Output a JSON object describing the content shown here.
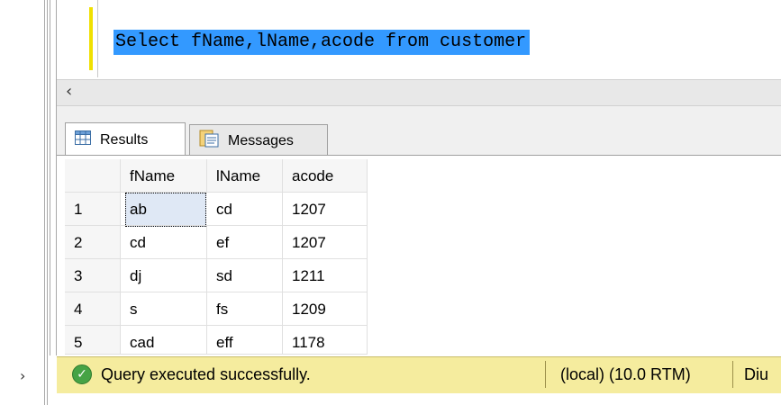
{
  "editor": {
    "sql": "Select fName,lName,acode from customer"
  },
  "tabs": {
    "results": "Results",
    "messages": "Messages"
  },
  "grid": {
    "columns": [
      "fName",
      "lName",
      "acode"
    ],
    "rows": [
      {
        "num": "1",
        "fName": "ab",
        "lName": "cd",
        "acode": "1207"
      },
      {
        "num": "2",
        "fName": "cd",
        "lName": "ef",
        "acode": "1207"
      },
      {
        "num": "3",
        "fName": "dj",
        "lName": "sd",
        "acode": "1211"
      },
      {
        "num": "4",
        "fName": "s",
        "lName": "fs",
        "acode": "1209"
      },
      {
        "num": "5",
        "fName": "cad",
        "lName": "eff",
        "acode": "1178"
      }
    ]
  },
  "status": {
    "message": "Query executed successfully.",
    "server": "(local) (10.0 RTM)",
    "user": "Diu"
  },
  "icons": {
    "success": "check-circle-icon",
    "results": "grid-icon",
    "messages": "message-icon",
    "scroll_left": "chevron-left-icon",
    "expand": "chevron-right-icon"
  },
  "colors": {
    "selection": "#3399ff",
    "status_bar": "#f5ec9e",
    "success": "#46a345",
    "change_marker": "#f0e000"
  }
}
